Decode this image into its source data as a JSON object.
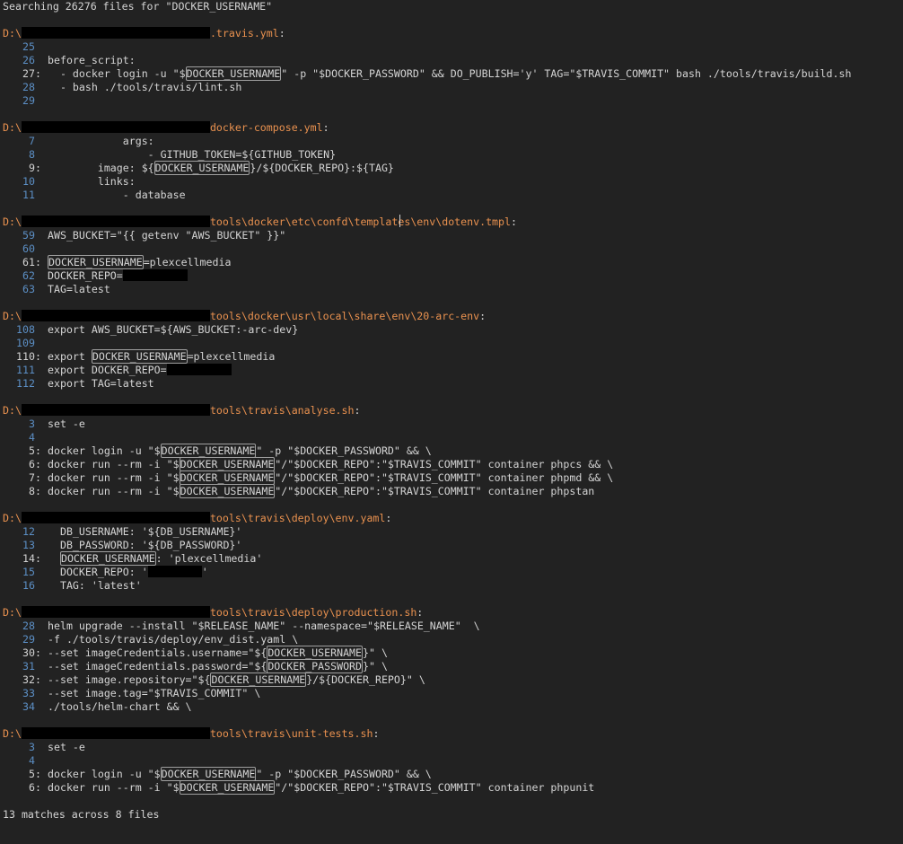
{
  "header": {
    "text": "Searching 26276 files for \"DOCKER_USERNAME\""
  },
  "drive_prefix": "D:\\",
  "files": [
    {
      "path": ".travis.yml",
      "lines": [
        {
          "num": "25",
          "match": false,
          "parts": [
            {
              "t": ""
            }
          ]
        },
        {
          "num": "26",
          "match": false,
          "parts": [
            {
              "t": "before_script:"
            }
          ]
        },
        {
          "num": "27",
          "match": true,
          "parts": [
            {
              "t": "  - docker login -u \"$"
            },
            {
              "t": "DOCKER_USERNAME",
              "hl": true
            },
            {
              "t": "\" -p \"$DOCKER_PASSWORD\" && DO_PUBLISH='y' TAG=\"$TRAVIS_COMMIT\" bash ./tools/travis/build.sh"
            }
          ]
        },
        {
          "num": "28",
          "match": false,
          "parts": [
            {
              "t": "  - bash ./tools/travis/lint.sh"
            }
          ]
        },
        {
          "num": "29",
          "match": false,
          "parts": [
            {
              "t": ""
            }
          ]
        }
      ]
    },
    {
      "path": "docker-compose.yml",
      "lines": [
        {
          "num": "7",
          "match": false,
          "parts": [
            {
              "t": "            args:"
            }
          ]
        },
        {
          "num": "8",
          "match": false,
          "parts": [
            {
              "t": "                - GITHUB_TOKEN=${GITHUB_TOKEN}"
            }
          ]
        },
        {
          "num": "9",
          "match": true,
          "parts": [
            {
              "t": "        image: ${"
            },
            {
              "t": "DOCKER_USERNAME",
              "hl": true
            },
            {
              "t": "}/${DOCKER_REPO}:${TAG}"
            }
          ]
        },
        {
          "num": "10",
          "match": false,
          "parts": [
            {
              "t": "        links:"
            }
          ]
        },
        {
          "num": "11",
          "match": false,
          "parts": [
            {
              "t": "            - database"
            }
          ]
        }
      ]
    },
    {
      "path": "tools\\docker\\etc\\confd\\templates\\env\\dotenv.tmpl",
      "lines": [
        {
          "num": "59",
          "match": false,
          "parts": [
            {
              "t": "AWS_BUCKET=\"{{ getenv \"AWS_BUCKET\" }}\""
            }
          ]
        },
        {
          "num": "60",
          "match": false,
          "parts": [
            {
              "t": ""
            }
          ]
        },
        {
          "num": "61",
          "match": true,
          "parts": [
            {
              "t": ""
            },
            {
              "t": "DOCKER_USERNAME",
              "hl": true
            },
            {
              "t": "=plexcellmedia"
            }
          ]
        },
        {
          "num": "62",
          "match": false,
          "parts": [
            {
              "t": "DOCKER_REPO="
            },
            {
              "redact": "inline"
            }
          ]
        },
        {
          "num": "63",
          "match": false,
          "parts": [
            {
              "t": "TAG=latest"
            }
          ]
        }
      ]
    },
    {
      "path": "tools\\docker\\usr\\local\\share\\env\\20-arc-env",
      "lines": [
        {
          "num": "108",
          "match": false,
          "parts": [
            {
              "t": "export AWS_BUCKET=${AWS_BUCKET:-arc-dev}"
            }
          ]
        },
        {
          "num": "109",
          "match": false,
          "parts": [
            {
              "t": ""
            }
          ]
        },
        {
          "num": "110",
          "match": true,
          "parts": [
            {
              "t": "export "
            },
            {
              "t": "DOCKER_USERNAME",
              "hl": true
            },
            {
              "t": "=plexcellmedia"
            }
          ]
        },
        {
          "num": "111",
          "match": false,
          "parts": [
            {
              "t": "export DOCKER_REPO="
            },
            {
              "redact": "inline"
            }
          ]
        },
        {
          "num": "112",
          "match": false,
          "parts": [
            {
              "t": "export TAG=latest"
            }
          ]
        }
      ]
    },
    {
      "path": "tools\\travis\\analyse.sh",
      "lines": [
        {
          "num": "3",
          "match": false,
          "parts": [
            {
              "t": "set -e"
            }
          ]
        },
        {
          "num": "4",
          "match": false,
          "parts": [
            {
              "t": ""
            }
          ]
        },
        {
          "num": "5",
          "match": true,
          "parts": [
            {
              "t": "docker login -u \"$"
            },
            {
              "t": "DOCKER_USERNAME",
              "hl": true
            },
            {
              "t": "\" -p \"$DOCKER_PASSWORD\" && \\"
            }
          ]
        },
        {
          "num": "6",
          "match": true,
          "parts": [
            {
              "t": "docker run --rm -i \"$"
            },
            {
              "t": "DOCKER_USERNAME",
              "hl": true
            },
            {
              "t": "\"/\"$DOCKER_REPO\":\"$TRAVIS_COMMIT\" container phpcs && \\"
            }
          ]
        },
        {
          "num": "7",
          "match": true,
          "parts": [
            {
              "t": "docker run --rm -i \"$"
            },
            {
              "t": "DOCKER_USERNAME",
              "hl": true
            },
            {
              "t": "\"/\"$DOCKER_REPO\":\"$TRAVIS_COMMIT\" container phpmd && \\"
            }
          ]
        },
        {
          "num": "8",
          "match": true,
          "parts": [
            {
              "t": "docker run --rm -i \"$"
            },
            {
              "t": "DOCKER_USERNAME",
              "hl": true
            },
            {
              "t": "\"/\"$DOCKER_REPO\":\"$TRAVIS_COMMIT\" container phpstan"
            }
          ]
        }
      ]
    },
    {
      "path": "tools\\travis\\deploy\\env.yaml",
      "lines": [
        {
          "num": "12",
          "match": false,
          "parts": [
            {
              "t": "  DB_USERNAME: '${DB_USERNAME}'"
            }
          ]
        },
        {
          "num": "13",
          "match": false,
          "parts": [
            {
              "t": "  DB_PASSWORD: '${DB_PASSWORD}'"
            }
          ]
        },
        {
          "num": "14",
          "match": true,
          "parts": [
            {
              "t": "  "
            },
            {
              "t": "DOCKER_USERNAME",
              "hl": true
            },
            {
              "t": ": 'plexcellmedia'"
            }
          ]
        },
        {
          "num": "15",
          "match": false,
          "parts": [
            {
              "t": "  DOCKER_REPO: '"
            },
            {
              "redact": "small"
            },
            {
              "t": "'"
            }
          ]
        },
        {
          "num": "16",
          "match": false,
          "parts": [
            {
              "t": "  TAG: 'latest'"
            }
          ]
        }
      ]
    },
    {
      "path": "tools\\travis\\deploy\\production.sh",
      "lines": [
        {
          "num": "28",
          "match": false,
          "parts": [
            {
              "t": "helm upgrade --install \"$RELEASE_NAME\" --namespace=\"$RELEASE_NAME\"  \\"
            }
          ]
        },
        {
          "num": "29",
          "match": false,
          "parts": [
            {
              "t": "-f ./tools/travis/deploy/env_dist.yaml \\"
            }
          ]
        },
        {
          "num": "30",
          "match": true,
          "parts": [
            {
              "t": "--set imageCredentials.username=\"${"
            },
            {
              "t": "DOCKER_USERNAME",
              "hl": true
            },
            {
              "t": "}\" \\"
            }
          ]
        },
        {
          "num": "31",
          "match": false,
          "parts": [
            {
              "t": "--set imageCredentials.password=\"${"
            },
            {
              "t": "DOCKER_PASSWORD",
              "hl": true
            },
            {
              "t": "}\" \\"
            }
          ]
        },
        {
          "num": "32",
          "match": true,
          "parts": [
            {
              "t": "--set image.repository=\"${"
            },
            {
              "t": "DOCKER_USERNAME",
              "hl": true
            },
            {
              "t": "}/${DOCKER_REPO}\" \\"
            }
          ]
        },
        {
          "num": "33",
          "match": false,
          "parts": [
            {
              "t": "--set image.tag=\"$TRAVIS_COMMIT\" \\"
            }
          ]
        },
        {
          "num": "34",
          "match": false,
          "parts": [
            {
              "t": "./tools/helm-chart && \\"
            }
          ]
        }
      ]
    },
    {
      "path": "tools\\travis\\unit-tests.sh",
      "lines": [
        {
          "num": "3",
          "match": false,
          "parts": [
            {
              "t": "set -e"
            }
          ]
        },
        {
          "num": "4",
          "match": false,
          "parts": [
            {
              "t": ""
            }
          ]
        },
        {
          "num": "5",
          "match": true,
          "parts": [
            {
              "t": "docker login -u \"$"
            },
            {
              "t": "DOCKER_USERNAME",
              "hl": true
            },
            {
              "t": "\" -p \"$DOCKER_PASSWORD\" && \\"
            }
          ]
        },
        {
          "num": "6",
          "match": true,
          "parts": [
            {
              "t": "docker run --rm -i \"$"
            },
            {
              "t": "DOCKER_USERNAME",
              "hl": true
            },
            {
              "t": "\"/\"$DOCKER_REPO\":\"$TRAVIS_COMMIT\" container phpunit"
            }
          ]
        }
      ]
    }
  ],
  "footer": {
    "text": "13 matches across 8 files"
  }
}
